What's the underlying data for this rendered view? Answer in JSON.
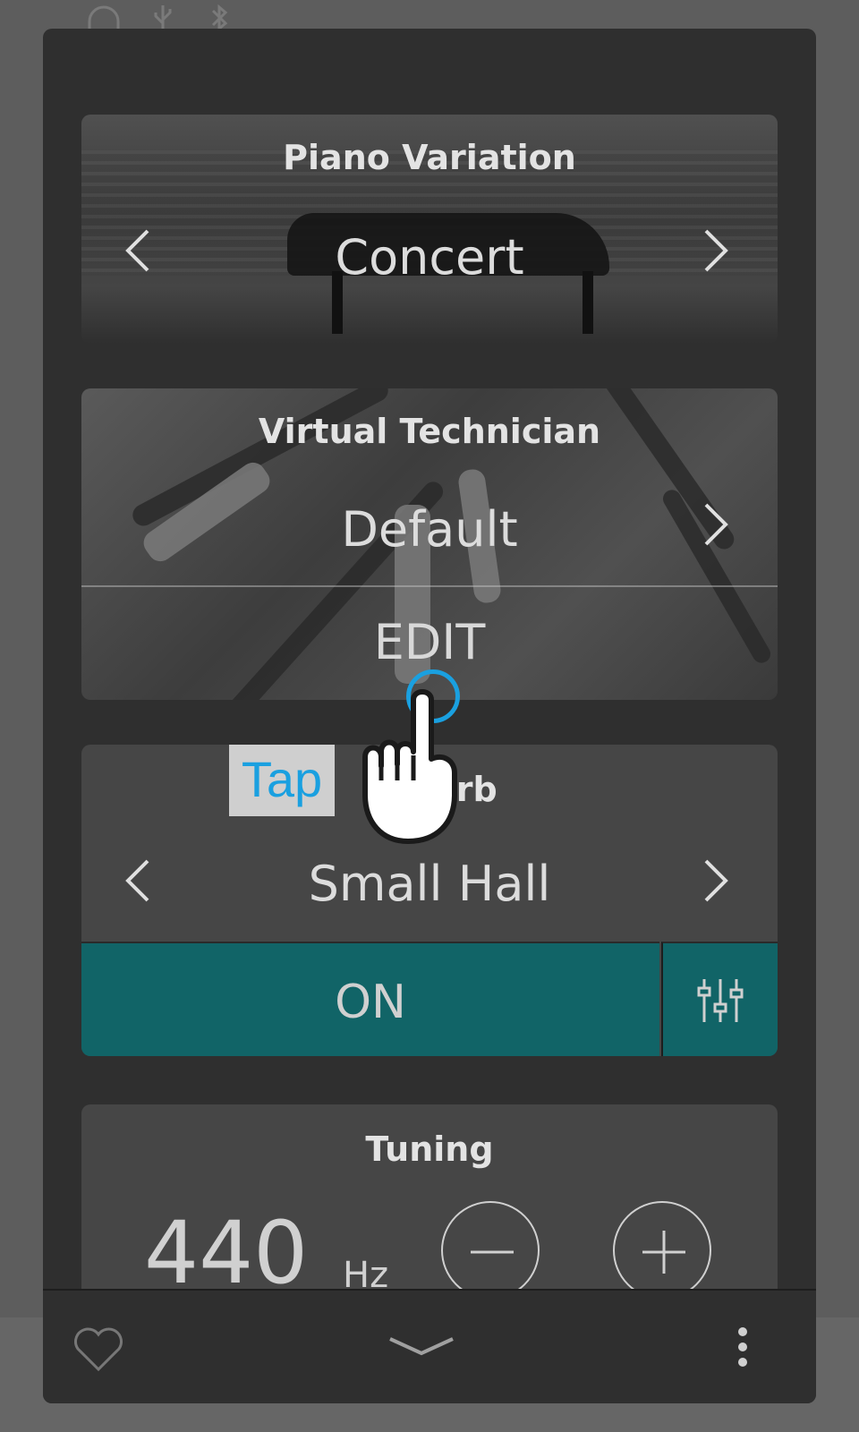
{
  "status_icons": [
    "headphones-icon",
    "usb-icon",
    "bluetooth-icon"
  ],
  "cards": {
    "variation": {
      "title": "Piano Variation",
      "value": "Concert"
    },
    "technician": {
      "title": "Virtual Technician",
      "value": "Default",
      "edit_label": "EDIT"
    },
    "reverb": {
      "title": "Reverb",
      "visible_title_fragment": "rb",
      "value": "Small Hall",
      "toggle_label": "ON"
    },
    "tuning": {
      "title": "Tuning",
      "value": "440",
      "unit": "Hz"
    }
  },
  "overlay": {
    "tap_label": "Tap"
  },
  "bottom_bar": {
    "icons": [
      "heart-icon",
      "chevron-down-icon",
      "more-vertical-icon"
    ]
  },
  "colors": {
    "accent": "#116467",
    "tap_blue": "#1aa0e0",
    "panel": "#2f2f2f",
    "card": "#464646"
  }
}
